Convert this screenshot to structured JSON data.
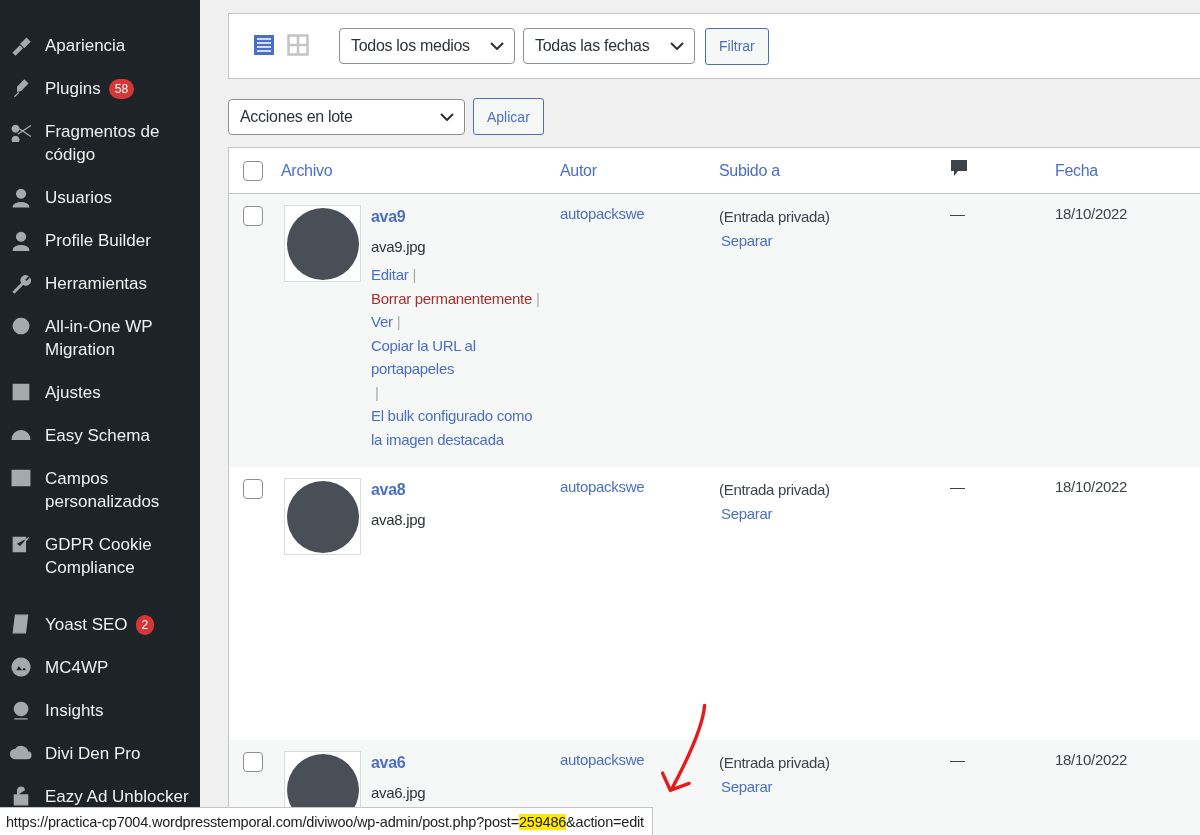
{
  "sidebar": {
    "items": [
      {
        "label": "Apariencia"
      },
      {
        "label": "Plugins",
        "badge": "58"
      },
      {
        "label": "Fragmentos de código"
      },
      {
        "label": "Usuarios"
      },
      {
        "label": "Profile Builder"
      },
      {
        "label": "Herramientas"
      },
      {
        "label": "All-in-One WP Migration"
      },
      {
        "label": "Ajustes"
      },
      {
        "label": "Easy Schema"
      },
      {
        "label": "Campos personalizados"
      },
      {
        "label": "GDPR Cookie Compliance"
      },
      {
        "label": "Yoast SEO",
        "badge": "2",
        "gap_before": true
      },
      {
        "label": "MC4WP"
      },
      {
        "label": "Insights"
      },
      {
        "label": "Divi Den Pro"
      },
      {
        "label": "Eazy Ad Unblocker"
      }
    ]
  },
  "filter_bar": {
    "views": [
      {
        "kind": "list",
        "selected": true
      },
      {
        "kind": "grid",
        "selected": false
      }
    ],
    "type_filter": "Todos los medios",
    "date_filter": "Todas las fechas",
    "filter_button": "Filtrar"
  },
  "bulk_actions": {
    "select": "Acciones en lote",
    "apply_button": "Aplicar"
  },
  "table": {
    "columns": [
      {
        "kind": "text",
        "label": "Archivo"
      },
      {
        "kind": "text",
        "label": "Autor"
      },
      {
        "kind": "text",
        "label": "Subido a"
      },
      {
        "kind": "comments"
      },
      {
        "kind": "text",
        "label": "Fecha"
      }
    ],
    "select_all_checked": false,
    "separator": "|",
    "rows": [
      {
        "title": "ava9",
        "file": "ava9.jpg",
        "checked": false,
        "author": "autopackswe",
        "uploaded_to": "(Entrada privada)",
        "detach": "Separar",
        "comments": "—",
        "date": "18/10/2022",
        "actions": [
          {
            "label": "Editar",
            "kind": "link"
          },
          {
            "label": "Borrar permanentemente",
            "kind": "danger"
          },
          {
            "label": "Ver",
            "kind": "link"
          },
          {
            "label": "Copiar la URL al portapapeles",
            "kind": "link"
          },
          {
            "label": "El bulk configurado como la imagen destacada",
            "kind": "link"
          }
        ]
      },
      {
        "title": "ava8",
        "file": "ava8.jpg",
        "checked": false,
        "author": "autopackswe",
        "uploaded_to": "(Entrada privada)",
        "detach": "Separar",
        "comments": "—",
        "date": "18/10/2022",
        "actions": []
      },
      {
        "title": "ava6",
        "file": "ava6.jpg",
        "checked": false,
        "author": "autopackswe",
        "uploaded_to": "(Entrada privada)",
        "detach": "Separar",
        "comments": "—",
        "date": "18/10/2022",
        "actions": []
      }
    ]
  },
  "status_bar": {
    "url_prefix": "https://practica-cp7004.wordpresstemporal.com/diviwoo/wp-admin/post.php?post=",
    "url_highlight": "259486",
    "url_suffix": "&action=edit"
  }
}
